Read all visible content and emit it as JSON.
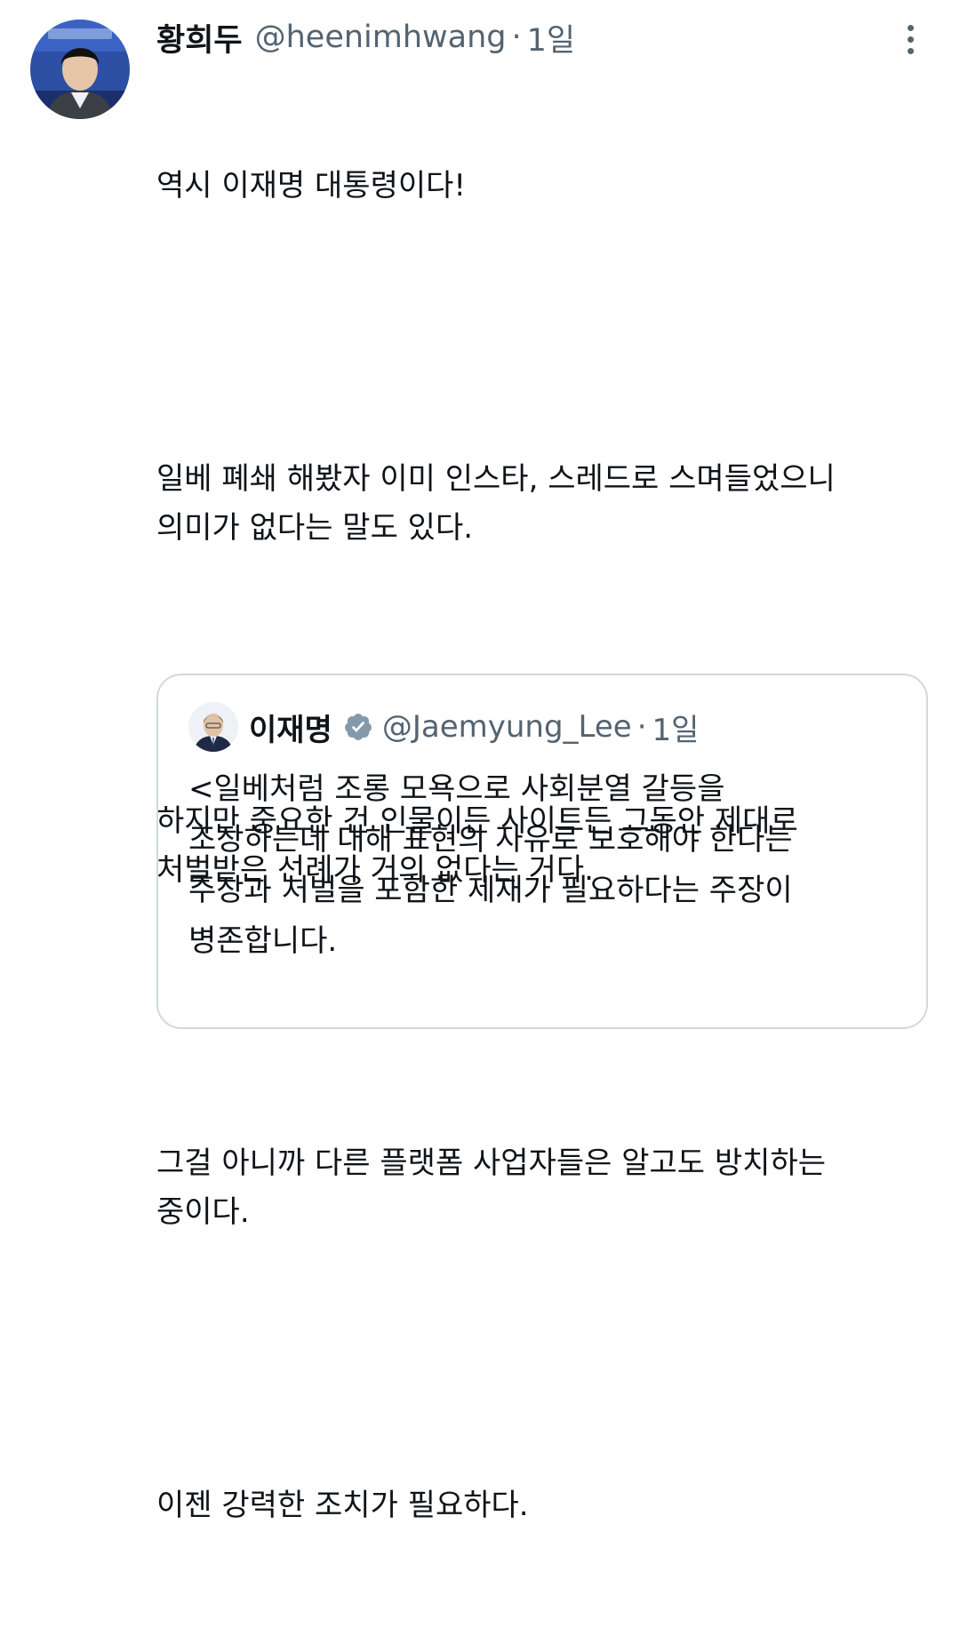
{
  "tweet": {
    "display_name": "황희두",
    "handle": "@heenimhwang",
    "separator": "·",
    "time": "1일",
    "paragraphs": [
      "역시 이재명 대통령이다!",
      "일베 폐쇄 해봤자 이미 인스타, 스레드로 스며들었으니\n의미가 없다는 말도 있다.",
      "하지만 중요한 건 인물이든 사이트든 그동안 제대로\n처벌받은 선례가 거의 없다는 거다.",
      "그걸 아니까 다른 플랫폼 사업자들은 알고도 방치하는\n중이다.",
      "이젠 강력한 조치가 필요하다."
    ],
    "avatar_icon": "user-avatar-photo",
    "more_icon": "more-vertical-icon"
  },
  "quote": {
    "display_name": "이재명",
    "verified_icon": "verified-badge-icon",
    "verified_color": "#829aab",
    "handle": "@Jaemyung_Lee",
    "separator": "·",
    "time": "1일",
    "text": "<일베처럼 조롱 모욕으로 사회분열 갈등을\n조장하는데 대해 표현의 자유로 보호해야 한다는\n주장과 처벌을 포함한 제재가 필요하다는 주장이\n병존합니다."
  },
  "colors": {
    "text": "#0f1419",
    "secondary": "#536471",
    "border": "#cfd9de"
  }
}
